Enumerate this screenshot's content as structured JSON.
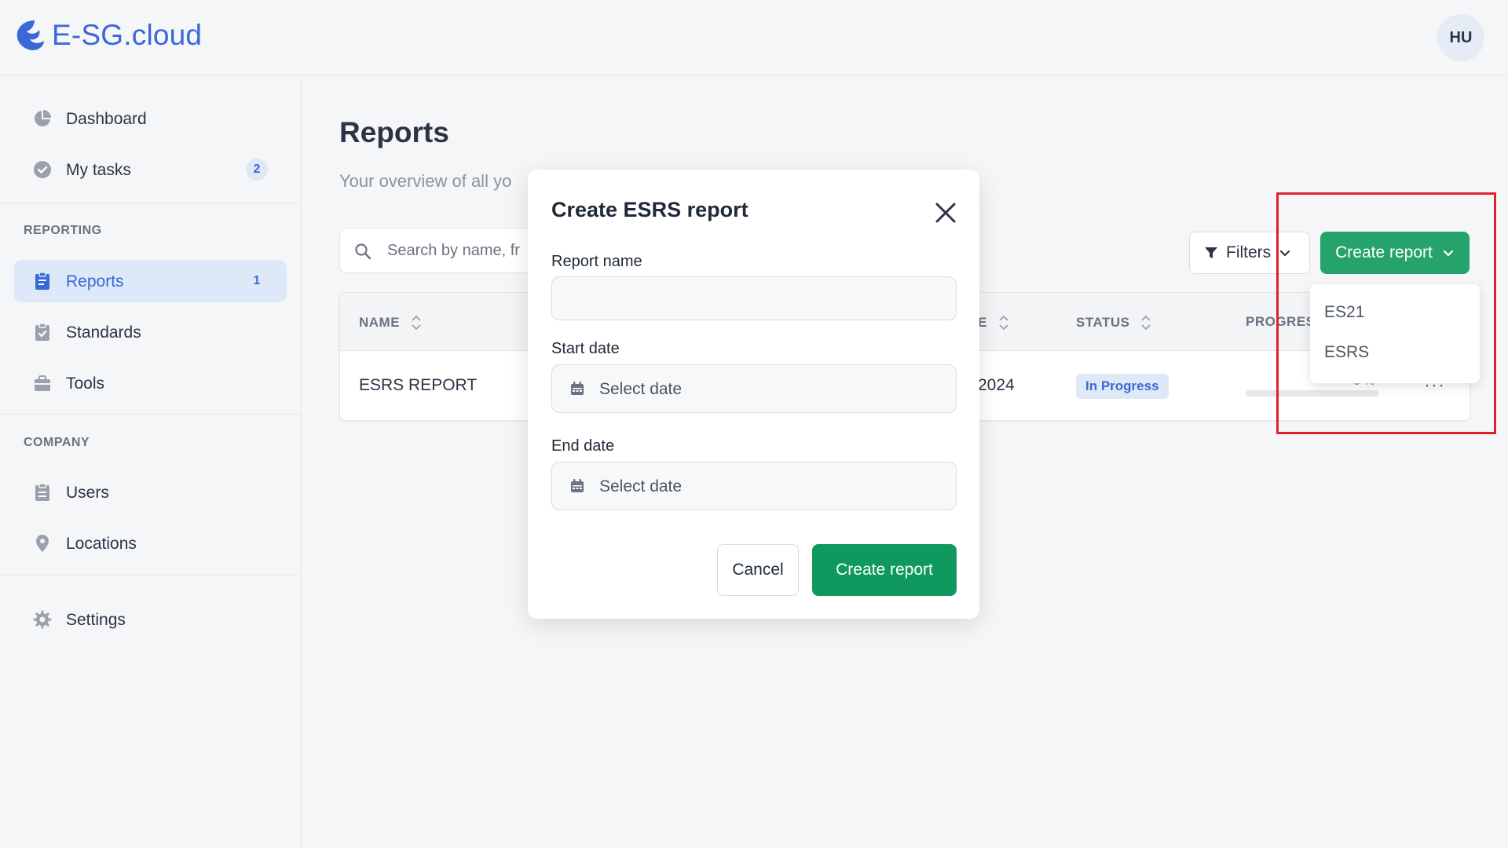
{
  "app": {
    "logo_text": "E-SG.cloud",
    "user_initials": "HU",
    "brand_color": "#3a68d6",
    "accent_color": "#25a36b"
  },
  "sidebar": {
    "items": [
      {
        "label": "Dashboard",
        "icon": "pie-chart-icon"
      },
      {
        "label": "My tasks",
        "icon": "check-circle-icon",
        "badge": "2"
      },
      {
        "label": "Reports",
        "icon": "clipboard-icon",
        "badge": "1",
        "active": true
      },
      {
        "label": "Standards",
        "icon": "clipboard-check-icon"
      },
      {
        "label": "Tools",
        "icon": "briefcase-icon"
      },
      {
        "label": "Users",
        "icon": "users-icon"
      },
      {
        "label": "Locations",
        "icon": "map-pin-icon"
      },
      {
        "label": "Settings",
        "icon": "gear-icon"
      }
    ],
    "sections": {
      "reporting": "REPORTING",
      "company": "COMPANY"
    }
  },
  "main": {
    "title": "Reports",
    "subtitle": "Your overview of all yo",
    "search_placeholder": "Search by name, fr",
    "filters_label": "Filters",
    "create_label": "Create report",
    "dropdown_options": [
      "ES21",
      "ESRS"
    ],
    "table": {
      "headers": [
        "NAME",
        "E",
        "STATUS",
        "PROGRES"
      ],
      "rows": [
        {
          "name": "ESRS REPORT",
          "date": "2024",
          "status": "In Progress",
          "progress": "0 %",
          "progress_value": 0,
          "more": "···"
        }
      ]
    }
  },
  "modal": {
    "title": "Create ESRS report",
    "report_name_label": "Report name",
    "report_name_value": "",
    "start_date_label": "Start date",
    "start_date_placeholder": "Select date",
    "end_date_label": "End date",
    "end_date_placeholder": "Select date",
    "cancel_label": "Cancel",
    "submit_label": "Create report"
  }
}
